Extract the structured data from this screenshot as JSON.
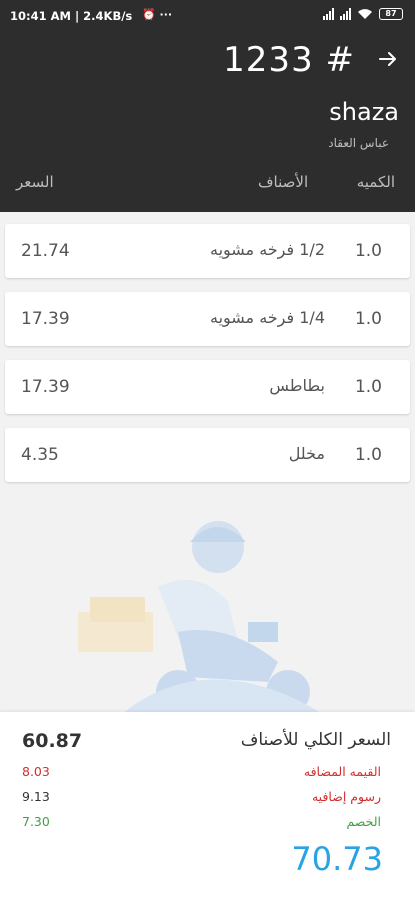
{
  "status_bar": {
    "time": "10:41 AM | 2.4KB/s",
    "battery": "87"
  },
  "header": {
    "order_number": "1233 #",
    "customer_name": "shaza",
    "secondary_name": "عباس العقاد",
    "columns": {
      "price": "السعر",
      "items": "الأصناف",
      "quantity": "الكميه"
    }
  },
  "items": [
    {
      "price": "21.74",
      "name": "1/2 فرخه مشويه",
      "qty": "1.0"
    },
    {
      "price": "17.39",
      "name": "1/4 فرخه مشويه",
      "qty": "1.0"
    },
    {
      "price": "17.39",
      "name": "بطاطس",
      "qty": "1.0"
    },
    {
      "price": "4.35",
      "name": "مخلل",
      "qty": "1.0"
    }
  ],
  "summary": {
    "items_total_label": "السعر الكلي للأصناف",
    "items_total": "60.87",
    "vat_label": "القيمه المضافه",
    "vat": "8.03",
    "fees_label": "رسوم إضافيه",
    "fees": "9.13",
    "discount_label": "الخصم",
    "discount": "7.30",
    "grand_total": "70.73"
  },
  "colors": {
    "header_bg": "#2d2d2d",
    "accent_total": "#29a3e6",
    "vat": "#d32f2f",
    "discount": "#43a047"
  }
}
